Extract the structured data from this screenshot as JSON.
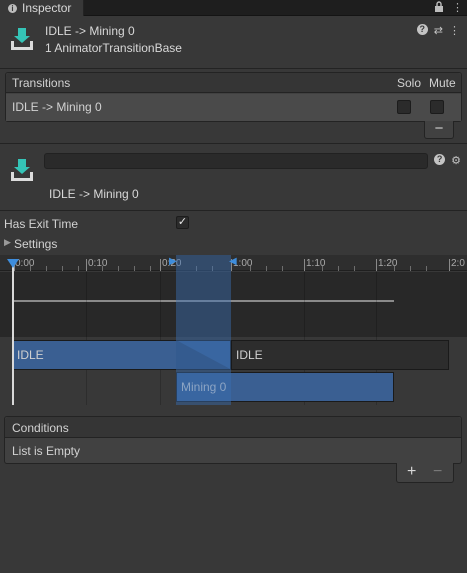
{
  "tab": {
    "label": "Inspector",
    "icon": "info-icon"
  },
  "header": {
    "title": "IDLE -> Mining 0",
    "subtitle": "1 AnimatorTransitionBase",
    "icon": "transition-icon"
  },
  "transitions": {
    "header": "Transitions",
    "solo_label": "Solo",
    "mute_label": "Mute",
    "rows": [
      {
        "label": "IDLE -> Mining 0",
        "solo": false,
        "mute": false
      }
    ],
    "remove_label": "−"
  },
  "detail": {
    "name_value": "",
    "subtitle": "IDLE -> Mining 0"
  },
  "has_exit_time": {
    "label": "Has Exit Time",
    "checked": true,
    "check_glyph": "✓"
  },
  "settings": {
    "label": "Settings",
    "expanded": false
  },
  "timeline": {
    "ticks": [
      "0:00",
      "0:10",
      "0:20",
      "1:00",
      "1:10",
      "1:20",
      "2:0"
    ],
    "source_label": "IDLE",
    "source_repeat_label": "IDLE",
    "dest_label": "Mining 0"
  },
  "conditions": {
    "header": "Conditions",
    "empty_text": "List is Empty",
    "add_label": "+",
    "remove_label": "−"
  },
  "colors": {
    "accent": "#3e8ddc",
    "bar_blue": "#3a5f92",
    "bar_dark": "#2d2d2d",
    "icon_teal": "#35c4b7"
  }
}
